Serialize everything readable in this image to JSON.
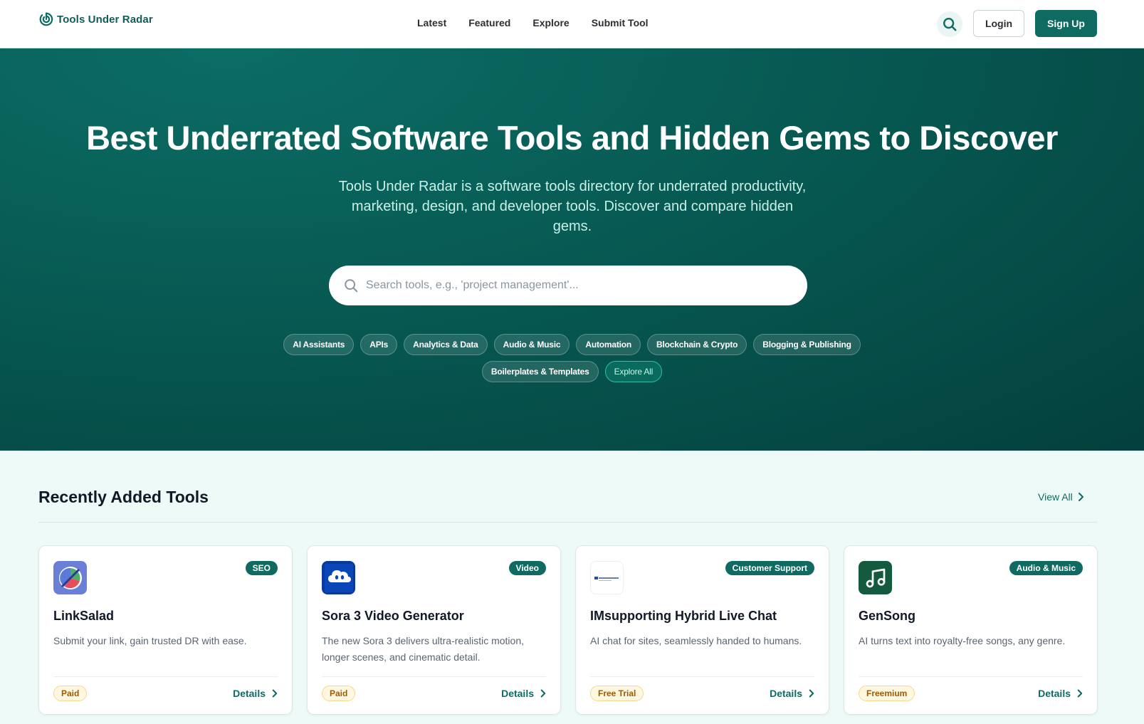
{
  "header": {
    "logo_text": "Tools Under Radar",
    "nav": [
      "Latest",
      "Featured",
      "Explore",
      "Submit Tool"
    ],
    "login_label": "Login",
    "signup_label": "Sign Up"
  },
  "hero": {
    "title": "Best Underrated Software Tools and Hidden Gems to Discover",
    "subtitle": "Tools Under Radar is a software tools directory for underrated productivity, marketing, design, and developer tools. Discover and compare hidden gems.",
    "search_placeholder": "Search tools, e.g., 'project management'...",
    "chips_row1": [
      "AI Assistants",
      "APIs",
      "Analytics & Data",
      "Audio & Music",
      "Automation",
      "Blockchain & Crypto",
      "Blogging & Publishing"
    ],
    "chips_row2": [
      "Boilerplates & Templates"
    ],
    "explore_all": "Explore All"
  },
  "recent": {
    "title": "Recently Added Tools",
    "view_all": "View All",
    "cards": [
      {
        "name": "LinkSalad",
        "category": "SEO",
        "description": "Submit your link, gain trusted DR with ease.",
        "pricing": "Paid",
        "details": "Details"
      },
      {
        "name": "Sora 3 Video Generator",
        "category": "Video",
        "description": "The new Sora 3 delivers ultra-realistic motion, longer scenes, and cinematic detail.",
        "pricing": "Paid",
        "details": "Details"
      },
      {
        "name": "IMsupporting Hybrid Live Chat",
        "category": "Customer Support",
        "description": "AI chat for sites, seamlessly handed to humans.",
        "pricing": "Free Trial",
        "details": "Details"
      },
      {
        "name": "GenSong",
        "category": "Audio & Music",
        "description": "AI turns text into royalty-free songs, any genre.",
        "pricing": "Freemium",
        "details": "Details"
      }
    ]
  },
  "colors": {
    "brand": "#0f6b62",
    "hero_dark": "#04403d",
    "badge_pricing_bg": "#fff7e0"
  }
}
